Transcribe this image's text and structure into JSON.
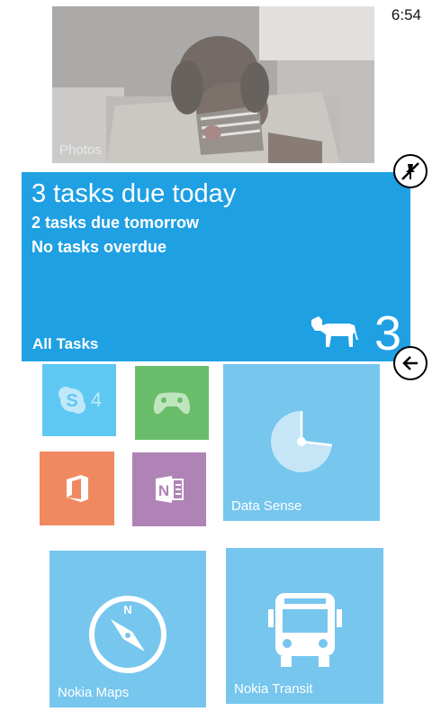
{
  "status_bar": {
    "time": "6:54"
  },
  "tiles": {
    "photos": {
      "label": "Photos"
    },
    "tasks": {
      "headline": "3 tasks due today",
      "line2": "2 tasks due tomorrow",
      "line3": "No tasks overdue",
      "app_name": "All Tasks",
      "count": "3",
      "icon": "cow-icon"
    },
    "skype": {
      "badge": "4",
      "icon": "skype-icon"
    },
    "xbox": {
      "icon": "xbox-controller-icon"
    },
    "office": {
      "icon": "office-icon"
    },
    "onenote": {
      "icon": "onenote-icon"
    },
    "data_sense": {
      "label": "Data Sense",
      "icon": "pie-chart-icon"
    },
    "nokia_maps": {
      "label": "Nokia Maps",
      "icon": "compass-icon"
    },
    "nokia_transit": {
      "label": "Nokia Transit",
      "icon": "bus-icon"
    }
  },
  "colors": {
    "accent": "#1fa0e3",
    "light_blue": "#76c6ee",
    "skype_blue": "#5ec8f3",
    "xbox_green": "#6abd6a",
    "office_orange": "#f08960",
    "onenote_purple": "#b083b7"
  },
  "controls": {
    "unpin_icon": "unpin-icon",
    "back_icon": "back-arrow-icon"
  }
}
